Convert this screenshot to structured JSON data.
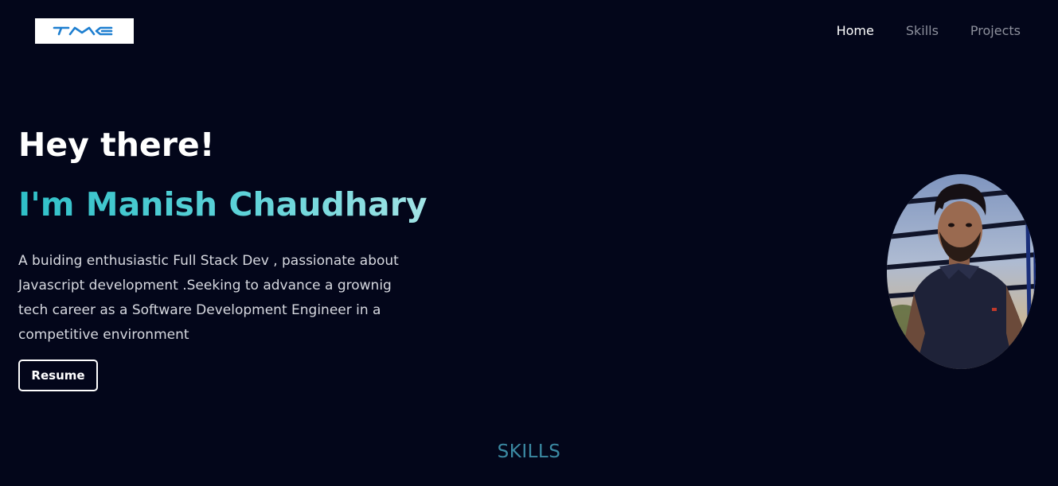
{
  "brand": {
    "logo_text": "TMC",
    "logo_icon": "tmc-logo-icon",
    "logo_color": "#1e7fd0"
  },
  "nav": {
    "items": [
      {
        "label": "Home",
        "active": true
      },
      {
        "label": "Skills",
        "active": false
      },
      {
        "label": "Projects",
        "active": false
      }
    ]
  },
  "hero": {
    "greeting": "Hey there!",
    "name": "I'm Manish Chaudhary",
    "description": "A buiding enthusiastic Full Stack Dev , passionate about Javascript development .Seeking to advance a grownig tech career as a Software Development Engineer in a competitive environment",
    "resume_label": "Resume"
  },
  "profile": {
    "photo": "profile-photo"
  },
  "sections": {
    "skills_title": "SKILLS"
  },
  "colors": {
    "background": "#03061a",
    "accent": "#2fc0c8",
    "section_title": "#3b8aa3",
    "nav_active": "#ffffff",
    "nav_inactive": "#8d909c"
  }
}
